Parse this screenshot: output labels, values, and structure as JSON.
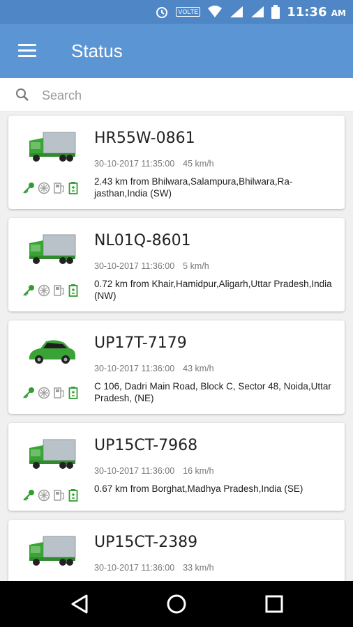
{
  "status_bar": {
    "time": "11:36",
    "ampm": "AM",
    "volte": "VOLTE"
  },
  "app_bar": {
    "title": "Status"
  },
  "search": {
    "placeholder": "Search",
    "value": ""
  },
  "vehicles": [
    {
      "plate": "HR55W-0861",
      "datetime": "30-10-2017 11:35:00",
      "speed": "45 km/h",
      "address": "2.43 km from Bhilwara,Salampura,Bhilwara,Ra-jasthan,India (SW)",
      "type": "truck"
    },
    {
      "plate": "NL01Q-8601",
      "datetime": "30-10-2017 11:36:00",
      "speed": "5 km/h",
      "address": "0.72 km from Khair,Hamidpur,Aligarh,Uttar Pradesh,India (NW)",
      "type": "truck"
    },
    {
      "plate": "UP17T-7179",
      "datetime": "30-10-2017 11:36:00",
      "speed": "43 km/h",
      "address": "C 106, Dadri Main Road, Block C, Sector 48, Noida,Uttar Pradesh, (NE)",
      "type": "car"
    },
    {
      "plate": "UP15CT-7968",
      "datetime": "30-10-2017 11:36:00",
      "speed": "16 km/h",
      "address": "0.67 km from Borghat,Madhya Pradesh,India (SE)",
      "type": "truck"
    },
    {
      "plate": "UP15CT-2389",
      "datetime": "30-10-2017 11:36:00",
      "speed": "33 km/h",
      "address": "",
      "type": "truck"
    }
  ],
  "colors": {
    "status_bar": "#4f86c6",
    "app_bar": "#5b95d4",
    "vehicle_green": "#3aa335",
    "status_icon_green": "#2f9e2f",
    "status_icon_gray": "#9e9e9e"
  },
  "icons": {
    "status_row": [
      "ignition-key-icon",
      "ac-icon",
      "fuel-icon",
      "battery-icon"
    ]
  }
}
